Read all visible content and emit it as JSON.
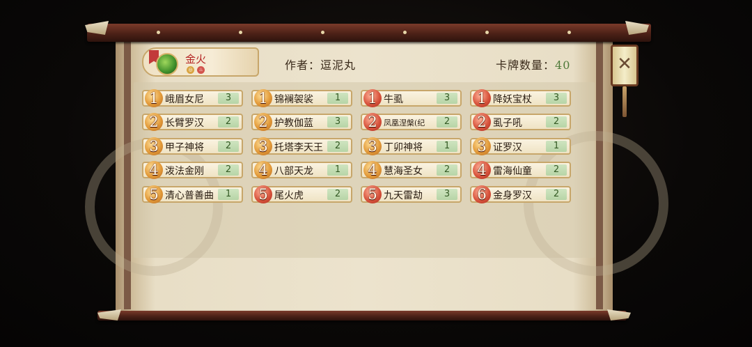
{
  "header": {
    "deck_name": "金火",
    "author_label": "作者：",
    "author_name": "逗泥丸",
    "count_label": "卡牌数量：",
    "count_value": "40",
    "deck_coin_icons": [
      "coin-icon",
      "flame-icon"
    ]
  },
  "close_icon": "close-icon",
  "colors": {
    "cost_gold": "#e39b3a",
    "cost_red": "#d9553e",
    "qty_green": "#b7d5a7",
    "rod": "#4c2117",
    "parchment": "#ece3cd"
  },
  "columns": [
    [
      {
        "cost": "1",
        "name": "峨眉女尼",
        "qty": "3",
        "style": "gold"
      },
      {
        "cost": "2",
        "name": "长臂罗汉",
        "qty": "2",
        "style": "gold"
      },
      {
        "cost": "3",
        "name": "甲子神将",
        "qty": "2",
        "style": "gold"
      },
      {
        "cost": "4",
        "name": "泼法金刚",
        "qty": "2",
        "style": "gold"
      },
      {
        "cost": "5",
        "name": "清心普善曲",
        "qty": "1",
        "style": "gold"
      }
    ],
    [
      {
        "cost": "1",
        "name": "锦襕袈裟",
        "qty": "1",
        "style": "gold"
      },
      {
        "cost": "2",
        "name": "护教伽蓝",
        "qty": "3",
        "style": "gold"
      },
      {
        "cost": "3",
        "name": "托塔李天王",
        "qty": "2",
        "style": "gold"
      },
      {
        "cost": "4",
        "name": "八部天龙",
        "qty": "1",
        "style": "gold"
      },
      {
        "cost": "5",
        "name": "尾火虎",
        "qty": "2",
        "style": "red"
      }
    ],
    [
      {
        "cost": "1",
        "name": "牛虱",
        "qty": "3",
        "style": "red"
      },
      {
        "cost": "2",
        "name": "凤凰涅槃(纪",
        "qty": "2",
        "style": "red"
      },
      {
        "cost": "3",
        "name": "丁卯神将",
        "qty": "1",
        "style": "gold"
      },
      {
        "cost": "4",
        "name": "慧海圣女",
        "qty": "2",
        "style": "gold"
      },
      {
        "cost": "5",
        "name": "九天雷劫",
        "qty": "3",
        "style": "red"
      }
    ],
    [
      {
        "cost": "1",
        "name": "降妖宝杖",
        "qty": "3",
        "style": "gold"
      },
      {
        "cost": "2",
        "name": "虱子吼",
        "qty": "2",
        "style": "red"
      },
      {
        "cost": "3",
        "name": "证罗汉",
        "qty": "1",
        "style": "gold"
      },
      {
        "cost": "4",
        "name": "雷海仙童",
        "qty": "2",
        "style": "red"
      },
      {
        "cost": "6",
        "name": "金身罗汉",
        "qty": "2",
        "style": "gold"
      }
    ]
  ]
}
